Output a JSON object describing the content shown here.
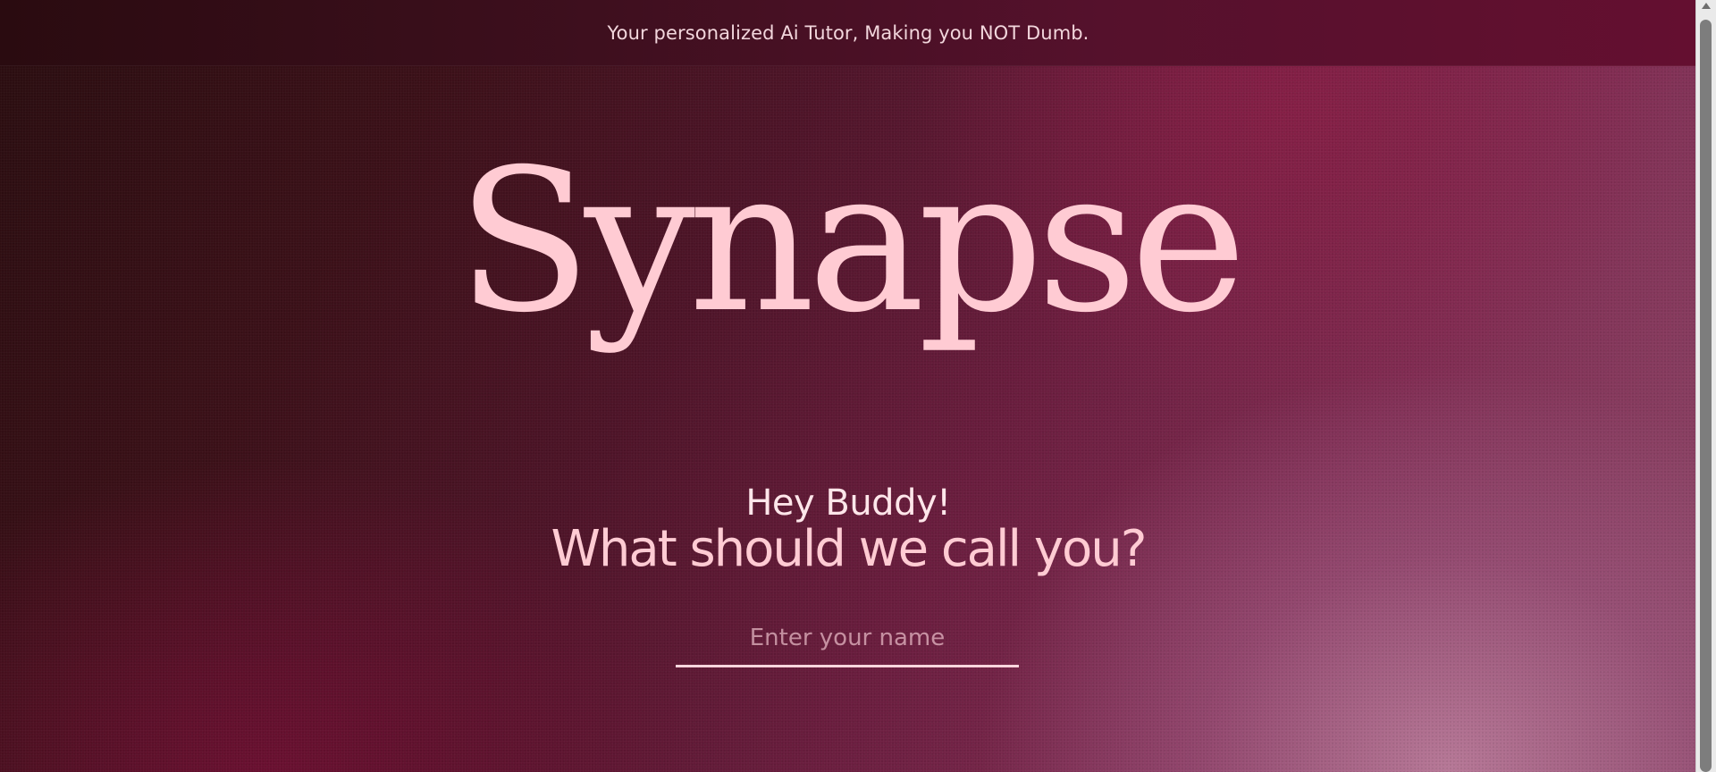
{
  "banner": {
    "text": "Your personalized Ai Tutor, Making you NOT Dumb."
  },
  "hero": {
    "logo": "Synapse",
    "greeting": "Hey Buddy!",
    "question": "What should we call you?"
  },
  "name_input": {
    "placeholder": "Enter your name",
    "value": ""
  },
  "colors": {
    "accent_pink": "#ffcbd3",
    "banner_bg": "#55112c",
    "background_dark": "#2a0d10",
    "background_light": "#8e4a6a"
  }
}
